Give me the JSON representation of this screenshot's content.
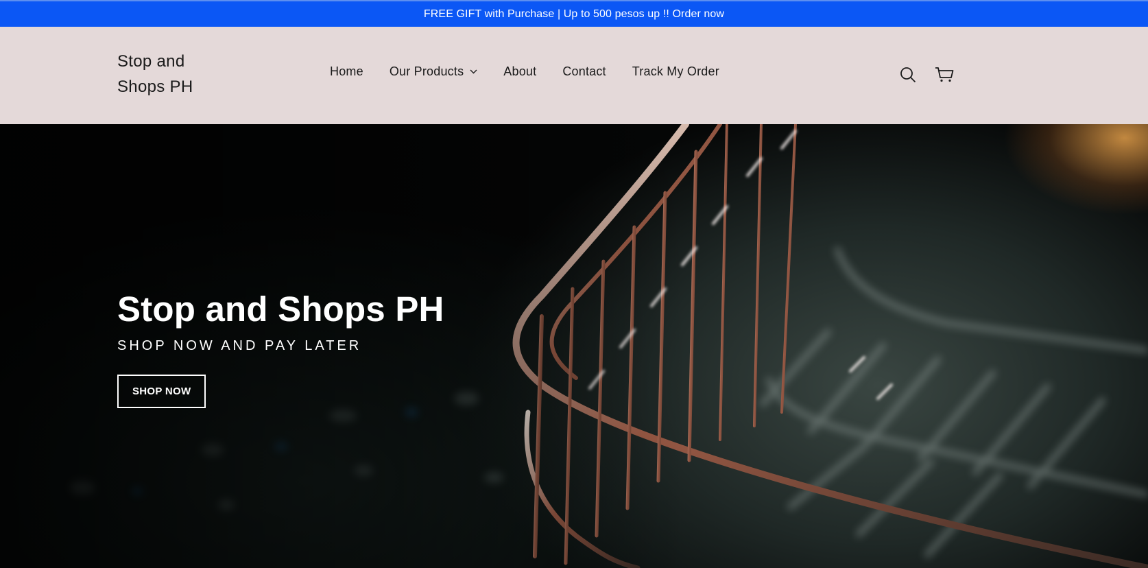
{
  "announcement": {
    "text": "FREE GIFT with Purchase | Up to 500 pesos up !! Order now",
    "bg_color": "#0b57f5"
  },
  "header": {
    "logo_line1": "Stop and",
    "logo_line2": "Shops PH",
    "bg_color": "#e4d9d9",
    "nav": [
      {
        "label": "Home"
      },
      {
        "label": "Our Products",
        "has_dropdown": true
      },
      {
        "label": "About"
      },
      {
        "label": "Contact"
      },
      {
        "label": "Track My Order"
      }
    ],
    "icons": [
      "search-icon",
      "cart-icon"
    ]
  },
  "hero": {
    "title": "Stop and Shops PH",
    "subtitle": "SHOP NOW AND PAY LATER",
    "button_label": "SHOP NOW",
    "image": "wire-shopping-basket"
  }
}
